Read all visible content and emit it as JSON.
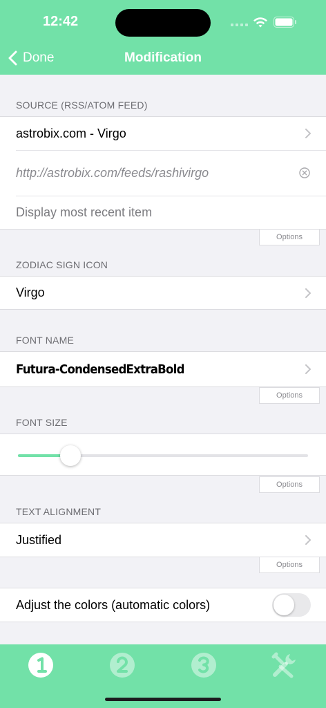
{
  "status": {
    "time": "12:42"
  },
  "nav": {
    "back_label": "Done",
    "title": "Modification"
  },
  "source": {
    "section_label": "SOURCE (RSS/ATOM FEED)",
    "feed_name": "astrobix.com - Virgo",
    "url_placeholder": "http://astrobix.com/feeds/rashivirgo",
    "display_mode": "Display most recent item",
    "options_label": "Options"
  },
  "zodiac": {
    "section_label": "ZODIAC SIGN ICON",
    "value": "Virgo"
  },
  "font_name": {
    "section_label": "FONT NAME",
    "value": "Futura-CondensedExtraBold",
    "options_label": "Options"
  },
  "font_size": {
    "section_label": "FONT SIZE",
    "slider_fraction": 0.18,
    "options_label": "Options"
  },
  "alignment": {
    "section_label": "TEXT ALIGNMENT",
    "value": "Justified",
    "options_label": "Options"
  },
  "colors": {
    "label": "Adjust the colors (automatic colors)",
    "toggle_on": false
  },
  "tabbar": {
    "tabs": [
      {
        "icon": "step-1-icon",
        "selected": true
      },
      {
        "icon": "step-2-icon",
        "selected": false
      },
      {
        "icon": "step-3-icon",
        "selected": false
      },
      {
        "icon": "tools-icon",
        "selected": false
      }
    ]
  },
  "theme": {
    "accent": "#72e1a8",
    "background": "#f2f2f6"
  }
}
